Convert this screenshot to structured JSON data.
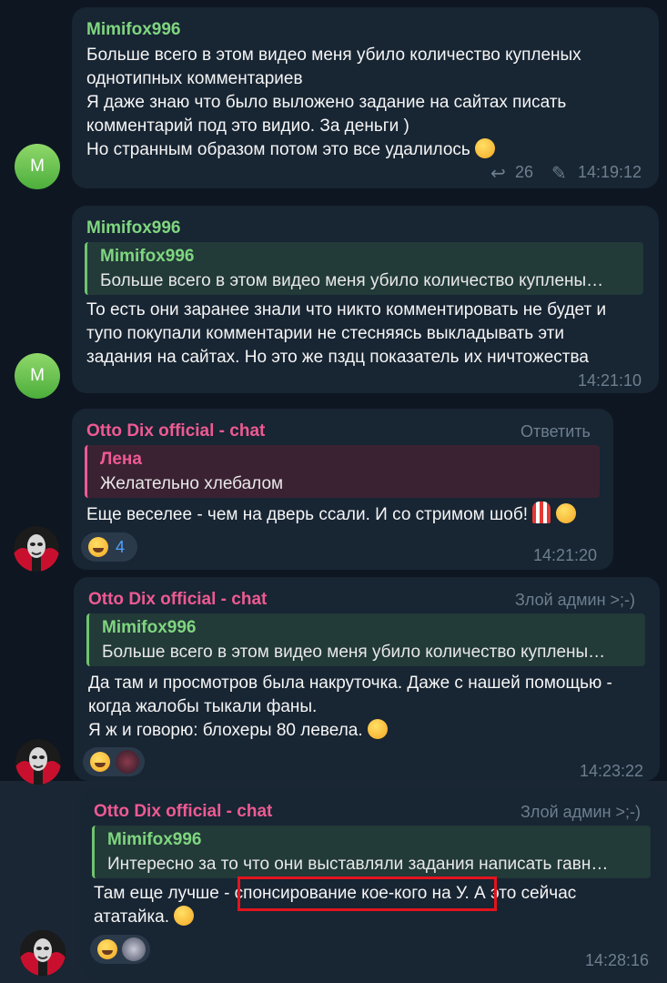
{
  "messages": [
    {
      "author": "Mimifox996",
      "avatar_letter": "M",
      "lines": [
        "Больше всего в этом видео меня убило  количество купленых",
        "однотипных комментариев",
        " Я даже знаю что было выложено задание на сайтах писать",
        "комментарий под это видио. За деньги )",
        "Но странным образом потом это все удалилось"
      ],
      "emoji": "laughing-tears",
      "replies_count": "26",
      "time": "14:19:12"
    },
    {
      "author": "Mimifox996",
      "avatar_letter": "M",
      "reply": {
        "author": "Mimifox996",
        "text": "Больше всего в этом видео меня убило  количество куплены…"
      },
      "lines": [
        "То есть они заранее знали что никто комментировать не будет и",
        "тупо покупали комментарии не стесняясь выкладывать эти",
        "задания на сайтах. Но это же пздц показатель их ничтожества"
      ],
      "time": "14:21:10"
    },
    {
      "author": "Otto Dix official - chat",
      "role": "Ответить",
      "reply": {
        "author": "Лена",
        "text": "Желательно хлебалом"
      },
      "lines": [
        "Еще веселее - чем на дверь ссали. И со стримом шоб!"
      ],
      "reaction_count": "4",
      "time": "14:21:20"
    },
    {
      "author": "Otto Dix official - chat",
      "role": "Злой админ >;-)",
      "reply": {
        "author": "Mimifox996",
        "text": "Больше всего в этом видео меня убило  количество куплены…"
      },
      "lines": [
        "Да там и просмотров была накруточка. Даже с нашей помощью -",
        "когда жалобы тыкали фаны.",
        "Я ж и говорю: блохеры 80 левела."
      ],
      "time": "14:23:22"
    },
    {
      "author": "Otto Dix official - chat",
      "role": "Злой админ >;-)",
      "reply": {
        "author": "Mimifox996",
        "text": "Интересно за то что они выставляли задания написать гавн…"
      },
      "lines": [
        "Там еще лучше - спонсирование кое-кого на У. А это сейчас",
        "ататайка."
      ],
      "time": "14:28:16"
    }
  ],
  "colors": {
    "background": "#0e1621",
    "bubble": "#182533",
    "green_name": "#7fd67f",
    "pink_name": "#ee5a92",
    "highlight": "#e3141e"
  }
}
